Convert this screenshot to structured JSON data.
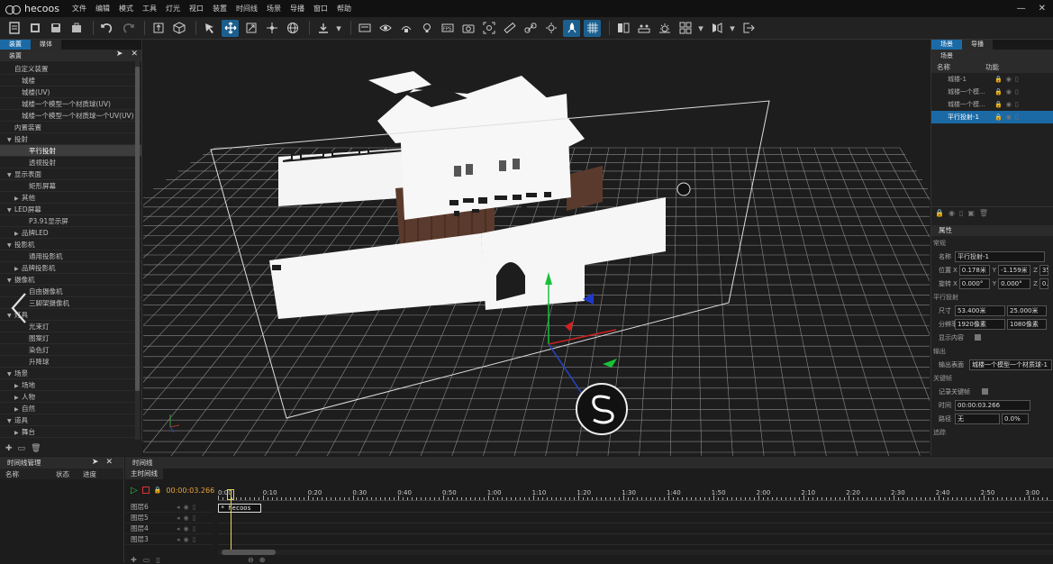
{
  "app": {
    "name": "hecoos"
  },
  "menu": [
    "文件",
    "编辑",
    "模式",
    "工具",
    "灯光",
    "视口",
    "装置",
    "时间线",
    "场景",
    "导播",
    "窗口",
    "帮助"
  ],
  "window_controls": {
    "minimize": "—",
    "close": "✕"
  },
  "left_panel": {
    "tabs": [
      "装置",
      "媒体"
    ],
    "header": "装置",
    "tree": [
      {
        "label": "自定义装置",
        "level": 0,
        "toggle": ""
      },
      {
        "label": "城楼",
        "level": 1,
        "toggle": ""
      },
      {
        "label": "城楼(UV)",
        "level": 1,
        "toggle": ""
      },
      {
        "label": "城楼一个模型一个材质球(UV)",
        "level": 1,
        "toggle": ""
      },
      {
        "label": "城楼一个模型一个材质球一个UV(UV)",
        "level": 1,
        "toggle": ""
      },
      {
        "label": "内置装置",
        "level": 0,
        "toggle": ""
      },
      {
        "label": "投射",
        "level": 0,
        "toggle": "▼"
      },
      {
        "label": "平行投射",
        "level": 2,
        "toggle": "",
        "selected": true
      },
      {
        "label": "透视投射",
        "level": 2,
        "toggle": ""
      },
      {
        "label": "显示表面",
        "level": 0,
        "toggle": "▼"
      },
      {
        "label": "矩形屏幕",
        "level": 2,
        "toggle": ""
      },
      {
        "label": "其他",
        "level": 1,
        "toggle": "▶"
      },
      {
        "label": "LED屏幕",
        "level": 0,
        "toggle": "▼"
      },
      {
        "label": "P3.91显示屏",
        "level": 2,
        "toggle": ""
      },
      {
        "label": "品牌LED",
        "level": 1,
        "toggle": "▶"
      },
      {
        "label": "投影机",
        "level": 0,
        "toggle": "▼"
      },
      {
        "label": "通用投影机",
        "level": 2,
        "toggle": ""
      },
      {
        "label": "品牌投影机",
        "level": 1,
        "toggle": "▶"
      },
      {
        "label": "摄像机",
        "level": 0,
        "toggle": "▼"
      },
      {
        "label": "自由摄像机",
        "level": 2,
        "toggle": ""
      },
      {
        "label": "三脚架摄像机",
        "level": 2,
        "toggle": ""
      },
      {
        "label": "灯具",
        "level": 0,
        "toggle": "▼"
      },
      {
        "label": "光束灯",
        "level": 2,
        "toggle": ""
      },
      {
        "label": "图案灯",
        "level": 2,
        "toggle": ""
      },
      {
        "label": "染色灯",
        "level": 2,
        "toggle": ""
      },
      {
        "label": "升降球",
        "level": 2,
        "toggle": ""
      },
      {
        "label": "场景",
        "level": 0,
        "toggle": "▼"
      },
      {
        "label": "场地",
        "level": 1,
        "toggle": "▶"
      },
      {
        "label": "人物",
        "level": 1,
        "toggle": "▶"
      },
      {
        "label": "自然",
        "level": 1,
        "toggle": "▶"
      },
      {
        "label": "道具",
        "level": 0,
        "toggle": "▼"
      },
      {
        "label": "舞台",
        "level": 1,
        "toggle": "▶"
      }
    ]
  },
  "right_panel": {
    "tabs": [
      "场景",
      "导播"
    ],
    "header": "场景",
    "columns": [
      "名称",
      "功能"
    ],
    "scene_items": [
      {
        "label": "城楼-1",
        "selected": false
      },
      {
        "label": "城楼一个模...",
        "selected": false
      },
      {
        "label": "城楼一个模...",
        "selected": false
      },
      {
        "label": "平行投射-1",
        "selected": true
      }
    ],
    "props": {
      "header": "属性",
      "general": "常规",
      "name_label": "名称",
      "name_value": "平行投射-1",
      "position_label": "位置",
      "pos_x": "0.178米",
      "pos_y": "-1.159米",
      "pos_z": "35.",
      "rotation_label": "旋转",
      "rot_x": "0.000°",
      "rot_y": "0.000°",
      "rot_z": "0.",
      "parallel_section": "平行投射",
      "size_label": "尺寸",
      "size_w": "53.400米",
      "size_h": "25.000米",
      "resolution_label": "分辨率",
      "res_w": "1920像素",
      "res_h": "1080像素",
      "show_content_label": "显示内容",
      "output_section": "输出",
      "output_surface_label": "输出表面",
      "output_surface_value": "城楼一个模型一个材质球-1",
      "keyframe_section": "关键帧",
      "record_keyframe_label": "记录关键帧",
      "time_label": "时间",
      "time_value": "00:00:03.266",
      "path_label": "路径",
      "path_value": "无",
      "path_pct": "0.0%",
      "tracking_section": "追踪"
    }
  },
  "timeline_manager": {
    "header": "时间线管理",
    "columns": [
      "名称",
      "状态",
      "进度"
    ]
  },
  "timeline": {
    "header": "时间线",
    "main_tab": "主时间线",
    "current_time": "00:00:03.266",
    "ruler": [
      "0:00",
      "0:10",
      "0:20",
      "0:30",
      "0:40",
      "0:50",
      "1:00",
      "1:10",
      "1:20",
      "1:30",
      "1:40",
      "1:50",
      "2:00",
      "2:10",
      "2:20",
      "2:30",
      "2:40",
      "2:50",
      "3:00"
    ],
    "layers": [
      "图层6",
      "图层5",
      "图层4",
      "图层3"
    ],
    "clip_label": "* hecoos"
  },
  "colors": {
    "accent": "#1b6aa6",
    "playhead": "#e5d75c"
  }
}
